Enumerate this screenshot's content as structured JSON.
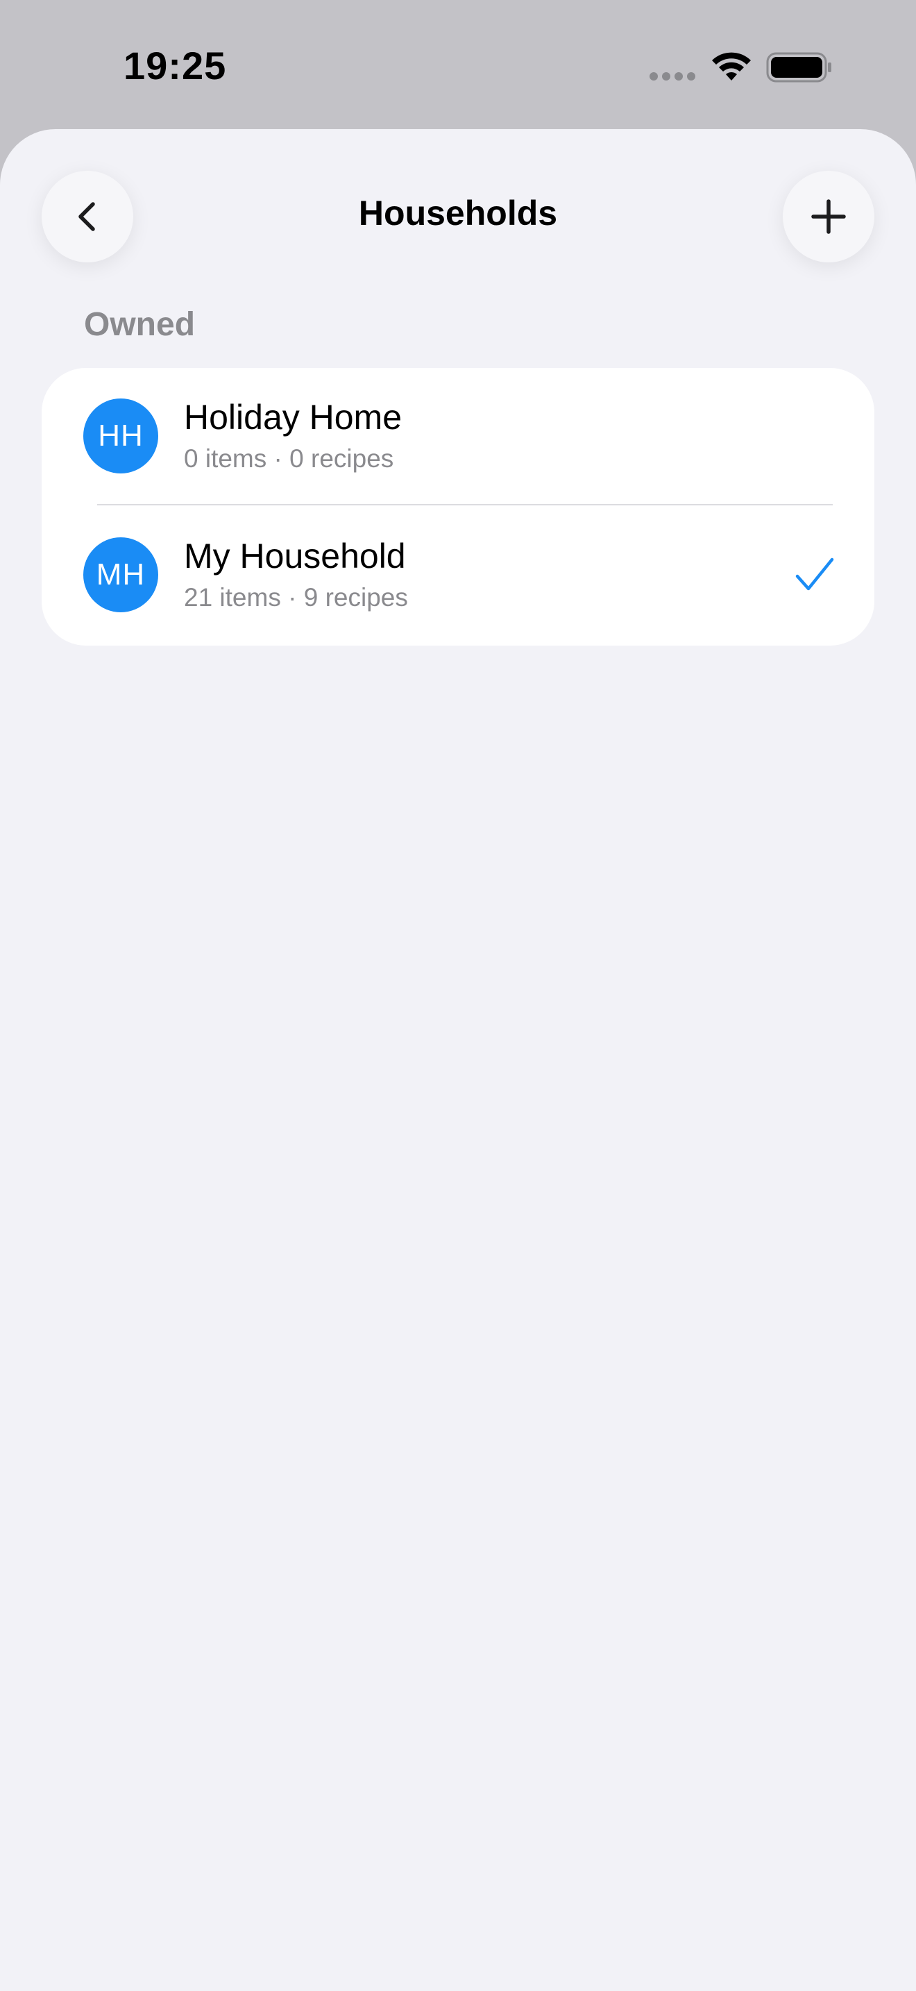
{
  "status_bar": {
    "time": "19:25"
  },
  "nav": {
    "title": "Households",
    "back_icon": "chevron-left-icon",
    "add_icon": "plus-icon"
  },
  "section": {
    "header": "Owned"
  },
  "households": [
    {
      "initials": "HH",
      "name": "Holiday Home",
      "summary": "0 items · 0 recipes",
      "selected": false
    },
    {
      "initials": "MH",
      "name": "My Household",
      "summary": "21 items · 9 recipes",
      "selected": true
    }
  ],
  "colors": {
    "accent": "#1a8cf5",
    "background": "#f2f2f7",
    "secondary_text": "#8a8a8e"
  }
}
